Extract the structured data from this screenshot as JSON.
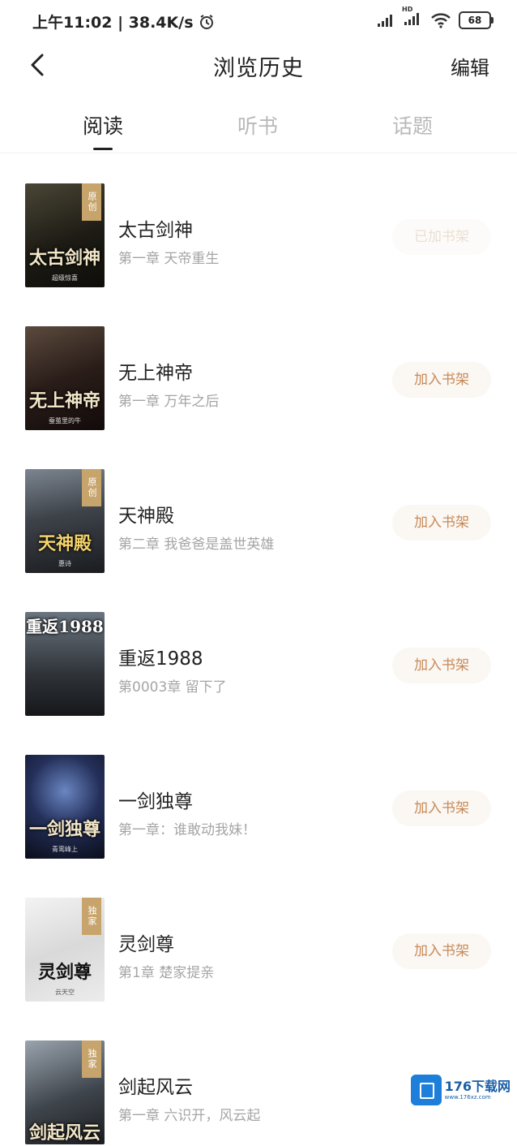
{
  "status": {
    "time_speed": "上午11:02 | 38.4K/s",
    "hd": "HD",
    "battery": "68"
  },
  "header": {
    "title": "浏览历史",
    "edit_label": "编辑"
  },
  "tabs": [
    {
      "label": "阅读",
      "active": true
    },
    {
      "label": "听书",
      "active": false
    },
    {
      "label": "话题",
      "active": false
    }
  ],
  "books": [
    {
      "name": "太古剑神",
      "chapter": "第一章 天帝重生",
      "button": "已加书架",
      "cover_title": "太古剑神",
      "cover_author": "超级惊喜",
      "ribbon": "原创"
    },
    {
      "name": "无上神帝",
      "chapter": "第一章 万年之后",
      "button": "加入书架",
      "cover_title": "无上神帝",
      "cover_author": "蚕茧里的牛"
    },
    {
      "name": "天神殿",
      "chapter": "第二章 我爸爸是盖世英雄",
      "button": "加入书架",
      "cover_title": "天神殿",
      "cover_author": "惠诗",
      "ribbon": "原创"
    },
    {
      "name": "重返1988",
      "chapter": "第0003章 留下了",
      "button": "加入书架",
      "cover_title": "重返1988"
    },
    {
      "name": "一剑独尊",
      "chapter": "第一章：谁敢动我妹！",
      "button": "加入书架",
      "cover_title": "一剑独尊",
      "cover_author": "青鸾峰上"
    },
    {
      "name": "灵剑尊",
      "chapter": "第1章 楚家提亲",
      "button": "加入书架",
      "cover_title": "灵剑尊",
      "cover_author": "云天空",
      "ribbon": "独家"
    },
    {
      "name": "剑起风云",
      "chapter": "第一章 六识开，风云起",
      "cover_title": "剑起风云",
      "ribbon": "独家"
    }
  ],
  "watermark": {
    "brand": "176下载网",
    "url": "www.176xz.com"
  },
  "colors": {
    "accent": "#c78a58",
    "button_bg": "#fbf7f3",
    "muted": "#a5a5a5",
    "active_tab": "#222222",
    "inactive_tab": "#b9b9b9"
  }
}
